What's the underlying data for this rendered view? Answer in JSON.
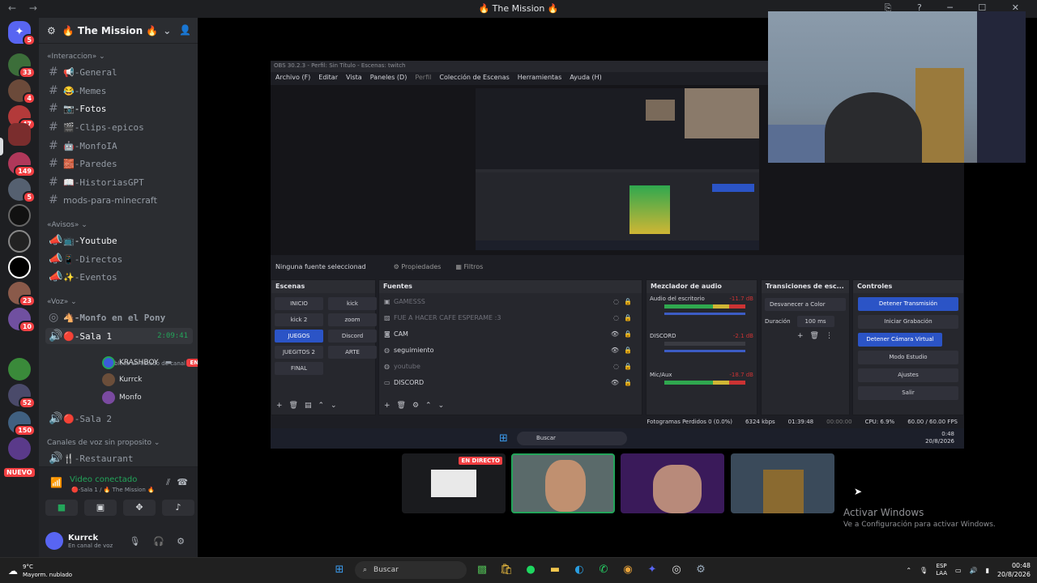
{
  "window": {
    "title": "🔥 The Mission 🔥",
    "nav": "← →",
    "controls": "⎘ ? ─ ☐ ✕"
  },
  "rail": {
    "badges": [
      "5",
      "33",
      "4",
      "47",
      "",
      "149",
      "5",
      "",
      "",
      "",
      "23",
      "10",
      "",
      "52",
      "150",
      ""
    ],
    "nuevo": "NUEVO"
  },
  "guild": {
    "name": "🔥 The Mission 🔥"
  },
  "categories": {
    "interaccion": "«Interaccion» ⌄",
    "avisos": "«Avisos» ⌄",
    "voz": "«Voz» ⌄",
    "canales_sin_proposito": "Canales de voz sin proposito ⌄"
  },
  "channels": {
    "general": "📢-General",
    "memes": "😂-Memes",
    "fotos": "📷-Fotos",
    "clips": "🎬-Clips-epicos",
    "monfoia": "🤖-MonfoIA",
    "paredes": "🧱-Paredes",
    "historias": "📖-HistoriasGPT",
    "mods": "mods-para-minecraft",
    "youtube": "📺-Youtube",
    "directos": "📱-Directos",
    "eventos": "✨-Eventos",
    "monfo_pony": "🐴-Monfo en el Pony",
    "sala1": "🔴-Sala 1",
    "sala1_time": "2:09:41",
    "sala1_status": "Establece un estado de canal ✎",
    "sala2": "🔴-Sala 2",
    "restaurant": "🍴-Restaurant"
  },
  "voice_users": [
    {
      "name": "KRASHBOY",
      "badge": "EN DIRECTO"
    },
    {
      "name": "Kurrck",
      "badge": ""
    },
    {
      "name": "Monfo",
      "badge": ""
    }
  ],
  "voice_panel": {
    "title": "Video conectado",
    "subtitle": "🔴-Sala 1 / 🔥 The Mission 🔥"
  },
  "user": {
    "name": "Kurrck",
    "status": "En canal de voz"
  },
  "obs": {
    "title": "OBS 30.2.3 - Perfil: Sin Título - Escenas: twitch",
    "menu": [
      "Archivo (F)",
      "Editar",
      "Vista",
      "Paneles (D)",
      "Perfil",
      "Colección de Escenas",
      "Herramientas",
      "Ayuda (H)"
    ],
    "no_source": "Ninguna fuente seleccionad",
    "properties": "⚙ Propiedades",
    "filters": "▦ Filtros",
    "docks": {
      "scenes": "Escenas",
      "sources": "Fuentes",
      "mixer": "Mezclador de audio",
      "transitions": "Transiciones de esc...",
      "controls": "Controles"
    },
    "scenes": [
      "INICIO",
      "kick",
      "kick 2",
      "zoom",
      "JUEGOS",
      "Discord",
      "JUEGITOS 2",
      "ARTE",
      "FINAL"
    ],
    "sources": [
      {
        "name": "GAMESSS",
        "dim": true
      },
      {
        "name": "FUE A HACER CAFE ESPERAME :3",
        "dim": true
      },
      {
        "name": "CAM",
        "dim": false
      },
      {
        "name": "seguimiento",
        "dim": false
      },
      {
        "name": "youtube",
        "dim": true
      },
      {
        "name": "DISCORD",
        "dim": false
      }
    ],
    "mixer": [
      {
        "name": "Audio del escritorio",
        "db": "-11.7 dB"
      },
      {
        "name": "DISCORD",
        "db": "-2.1 dB"
      },
      {
        "name": "Mic/Aux",
        "db": "-18.7 dB"
      }
    ],
    "transition": {
      "type": "Desvanecer a Color",
      "duration_label": "Duración",
      "duration": "100 ms"
    },
    "controls": [
      "Detener Transmisión",
      "Iniciar Grabación",
      "Detener Cámara Virtual",
      "Modo Estudio",
      "Ajustes",
      "Salir"
    ],
    "status": {
      "dropped": "Fotogramas Perdidos 0 (0.0%)",
      "kbps": "6324 kbps",
      "stream_time": "01:39:48",
      "rec_time": "00:00:00",
      "cpu": "CPU: 6.9%",
      "fps": "60.00 / 60.00 FPS"
    },
    "inner_taskbar": {
      "search": "Buscar",
      "time": "0:48",
      "date": "20/8/2026"
    }
  },
  "tiles": {
    "live_badge": "EN DIRECTO"
  },
  "activate": {
    "title": "Activar Windows",
    "subtitle": "Ve a Configuración para activar Windows."
  },
  "taskbar": {
    "temp": "9°C",
    "weather": "Mayorm. nublado",
    "search": "Buscar",
    "lang1": "ESP",
    "lang2": "LAA",
    "time": "00:48",
    "date": "20/8/2026"
  },
  "colors": {
    "discord_bg": "#2b2d31",
    "accent_green": "#23a55a",
    "live_red": "#f23f42",
    "obs_blue": "#2b54c6"
  }
}
